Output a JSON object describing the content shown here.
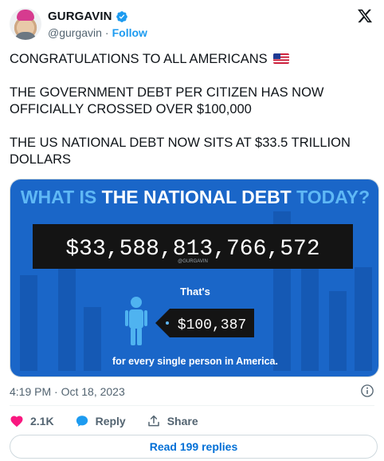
{
  "author": {
    "display_name": "GURGAVIN",
    "handle": "@gurgavin",
    "separator": "·",
    "follow_label": "Follow"
  },
  "tweet": {
    "line1": "CONGRATULATIONS TO ALL AMERICANS",
    "paragraph2": "THE GOVERNMENT DEBT PER CITIZEN HAS NOW OFFICIALLY CROSSED OVER $100,000",
    "paragraph3": "THE US NATIONAL DEBT NOW SITS AT $33.5 TRILLION DOLLARS",
    "flag_icon": "us-flag-emoji"
  },
  "media": {
    "headline_part1": "WHAT IS ",
    "headline_part2": "THE NATIONAL DEBT",
    "headline_part3": " TODAY?",
    "debt_value": "$33,588,813,766,572",
    "watermark": "@GURGAVIN",
    "thats_label": "That's",
    "per_person_value": "$100,387",
    "footer_text": "for every single person in America.",
    "colors": {
      "background": "#1a66c8",
      "headline_light": "#5fb8f5",
      "headline_white": "#ffffff",
      "counter_bg": "#141414",
      "person_icon": "#4fb3f0"
    }
  },
  "meta": {
    "time": "4:19 PM",
    "separator": "·",
    "date": "Oct 18, 2023"
  },
  "actions": {
    "like_count": "2.1K",
    "reply_label": "Reply",
    "share_label": "Share",
    "like_color": "#f91880"
  },
  "read_replies_label": "Read 199 replies"
}
